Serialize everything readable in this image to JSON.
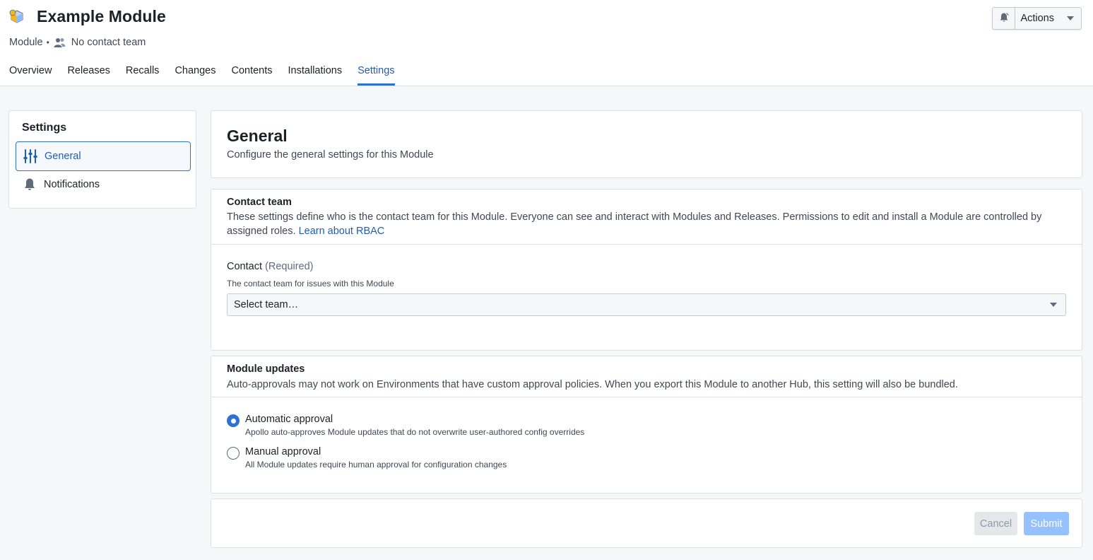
{
  "header": {
    "title": "Example Module",
    "meta_type": "Module",
    "meta_separator": "•",
    "meta_team": "No contact team",
    "actions_label": "Actions"
  },
  "tabs": [
    {
      "label": "Overview",
      "active": false
    },
    {
      "label": "Releases",
      "active": false
    },
    {
      "label": "Recalls",
      "active": false
    },
    {
      "label": "Changes",
      "active": false
    },
    {
      "label": "Contents",
      "active": false
    },
    {
      "label": "Installations",
      "active": false
    },
    {
      "label": "Settings",
      "active": true
    }
  ],
  "sidebar": {
    "title": "Settings",
    "items": [
      {
        "label": "General",
        "icon": "sliders-icon",
        "active": true
      },
      {
        "label": "Notifications",
        "icon": "bell-icon",
        "active": false
      }
    ]
  },
  "general": {
    "title": "General",
    "subtitle": "Configure the general settings for this Module"
  },
  "contact": {
    "title": "Contact team",
    "description": "These settings define who is the contact team for this Module. Everyone can see and interact with Modules and Releases. Permissions to edit and install a Module are controlled by assigned roles.",
    "link": "Learn about RBAC",
    "field_label": "Contact",
    "field_required": "(Required)",
    "field_help": "The contact team for issues with this Module",
    "select_placeholder": "Select team…"
  },
  "updates": {
    "title": "Module updates",
    "description": "Auto-approvals may not work on Environments that have custom approval policies. When you export this Module to another Hub, this setting will also be bundled.",
    "options": [
      {
        "label": "Automatic approval",
        "help": "Apollo auto-approves Module updates that do not overwrite user-authored config overrides",
        "selected": true
      },
      {
        "label": "Manual approval",
        "help": "All Module updates require human approval for configuration changes",
        "selected": false
      }
    ]
  },
  "footer": {
    "cancel_label": "Cancel",
    "submit_label": "Submit"
  },
  "colors": {
    "accent": "#2d72d2",
    "accent_text": "#215db0",
    "page_bg": "#f6f7f9",
    "border": "#dce0e5"
  }
}
